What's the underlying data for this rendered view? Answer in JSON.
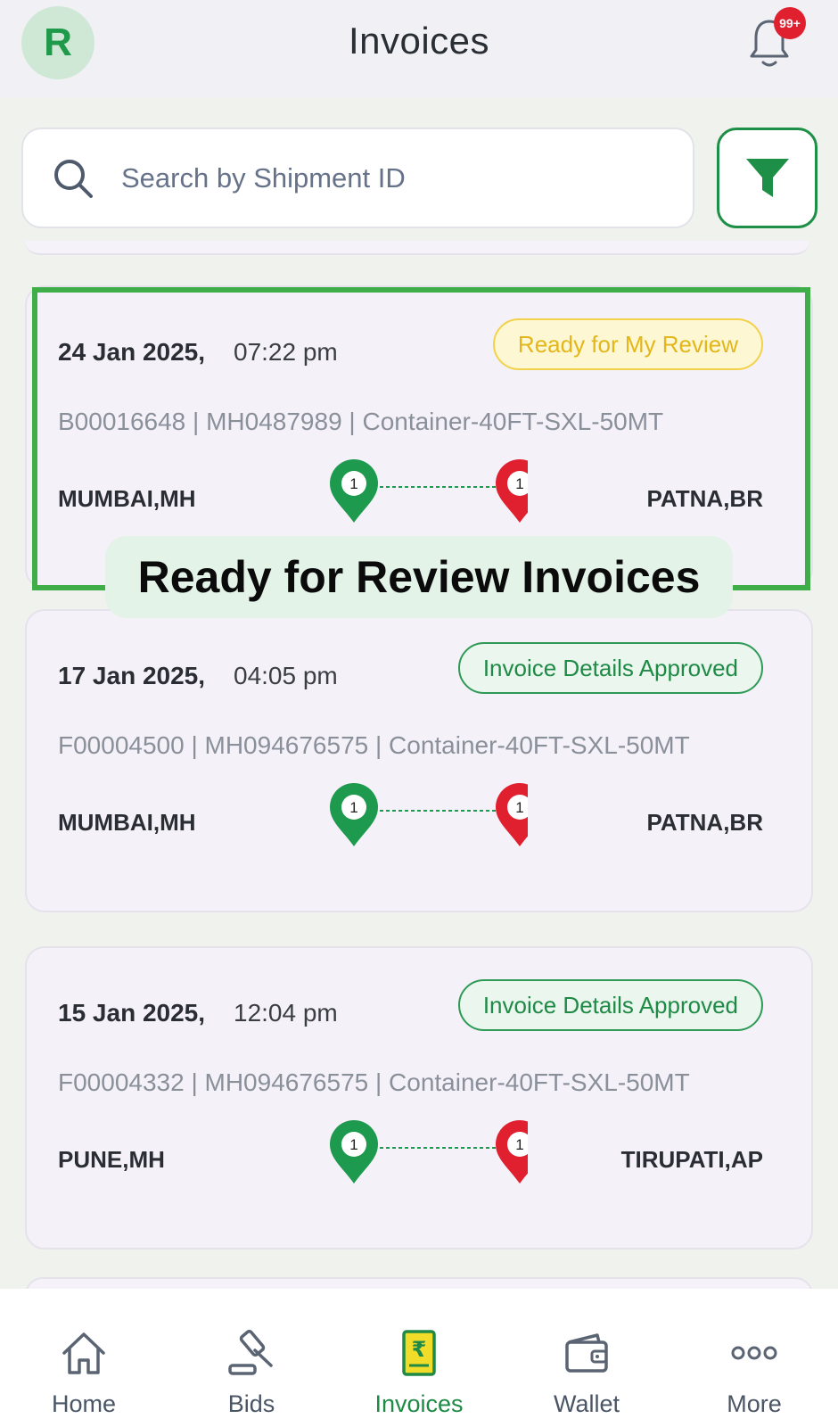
{
  "header": {
    "avatar_initial": "R",
    "title": "Invoices",
    "notification_badge": "99+"
  },
  "search": {
    "placeholder": "Search by Shipment ID"
  },
  "invoices": [
    {
      "date": "24 Jan 2025,",
      "time": "07:22 pm",
      "status": "Ready for My Review",
      "meta": "B00016648 | MH0487989 | Container-40FT-SXL-50MT",
      "origin": "MUMBAI,MH",
      "destination": "PATNA,BR",
      "origin_pin": "1",
      "destination_pin": "1"
    },
    {
      "date": "17 Jan 2025,",
      "time": "04:05 pm",
      "status": "Invoice Details Approved",
      "meta": "F00004500 | MH094676575 | Container-40FT-SXL-50MT",
      "origin": "MUMBAI,MH",
      "destination": "PATNA,BR",
      "origin_pin": "1",
      "destination_pin": "1"
    },
    {
      "date": "15 Jan 2025,",
      "time": "12:04 pm",
      "status": "Invoice Details Approved",
      "meta": "F00004332 | MH094676575 | Container-40FT-SXL-50MT",
      "origin": "PUNE,MH",
      "destination": "TIRUPATI,AP",
      "origin_pin": "1",
      "destination_pin": "1"
    }
  ],
  "callout": "Ready for Review Invoices",
  "nav": {
    "items": [
      {
        "label": "Home",
        "icon": "home-icon"
      },
      {
        "label": "Bids",
        "icon": "gavel-icon"
      },
      {
        "label": "Invoices",
        "icon": "invoice-icon"
      },
      {
        "label": "Wallet",
        "icon": "wallet-icon"
      },
      {
        "label": "More",
        "icon": "more-icon"
      }
    ],
    "active": "Invoices"
  },
  "colors": {
    "accent_green": "#1f8a45",
    "review_yellow": "#e3b719",
    "origin_pin": "#1e9a4f",
    "destination_pin": "#e0202f",
    "highlight_frame": "#3fae49"
  }
}
